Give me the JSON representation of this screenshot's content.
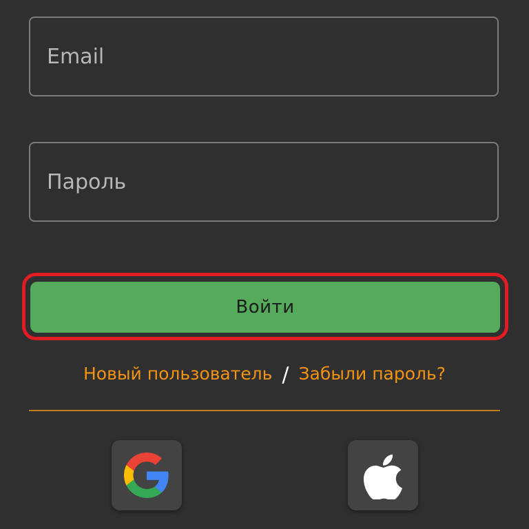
{
  "form": {
    "email_placeholder": "Email",
    "password_placeholder": "Пароль",
    "login_label": "Войти"
  },
  "links": {
    "new_user": "Новый пользователь",
    "separator": "/",
    "forgot_password": "Забыли пароль?"
  },
  "social": {
    "google_icon": "google-g-icon",
    "apple_icon": "apple-logo-icon"
  },
  "colors": {
    "background": "#2f2f2f",
    "accent": "#f39314",
    "login_button": "#55aa5b",
    "highlight": "#e01c24"
  }
}
